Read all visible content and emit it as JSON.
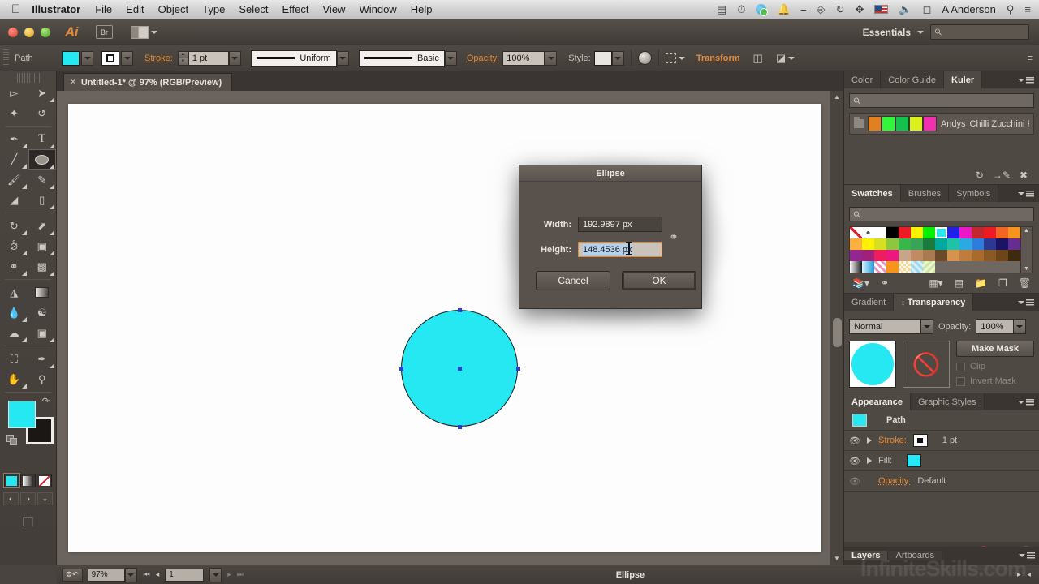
{
  "os_menu": {
    "apple_glyph": "\u0000",
    "app_name": "Illustrator",
    "items": [
      "File",
      "Edit",
      "Object",
      "Type",
      "Select",
      "Effect",
      "View",
      "Window",
      "Help"
    ],
    "user": "A Anderson",
    "right_icons": [
      "battery-icon",
      "clock-icon",
      "dropbox-icon",
      "bell-icon",
      "message-icon",
      "accessibility-icon",
      "time-machine-icon",
      "bluetooth-icon",
      "flag-icon",
      "volume-icon",
      "clock-icon",
      "spotlight-icon",
      "notification-center-icon"
    ]
  },
  "titlebar": {
    "logo": "Ai",
    "bridge_label": "Br",
    "workspace": "Essentials",
    "search_placeholder": ""
  },
  "control_bar": {
    "object_label": "Path",
    "fill_color": "#25e8f2",
    "stroke_label": "Stroke:",
    "stroke_weight": "1 pt",
    "profile": "Uniform",
    "brush": "Basic",
    "opacity_label": "Opacity:",
    "opacity_value": "100%",
    "style_label": "Style:",
    "transform_label": "Transform"
  },
  "document_tab": {
    "close_glyph": "×",
    "title": "Untitled-1* @ 97% (RGB/Preview)"
  },
  "canvas": {
    "shape_fill": "#25e8f2",
    "shape_stroke": "#1b1a1b",
    "anchor_color": "#2b3fd8"
  },
  "dialog": {
    "title": "Ellipse",
    "width_label": "Width:",
    "width_value": "192.9897 px",
    "height_label": "Height:",
    "height_value": "148.4536 px",
    "constrain_icon": "broken-chain-icon",
    "cancel_label": "Cancel",
    "ok_label": "OK"
  },
  "panels": {
    "kuler": {
      "tabs": [
        "Color",
        "Color Guide",
        "Kuler"
      ],
      "active_tab": "Kuler",
      "search_placeholder": "",
      "theme_name": "Andys",
      "theme_desc": "Chilli Zucchini P...",
      "theme_swatches": [
        "#e08020",
        "#34f53c",
        "#14c14c",
        "#dcf01c",
        "#f030b0"
      ],
      "footer_icons": [
        "refresh-icon",
        "add-theme-icon",
        "edit-theme-icon"
      ]
    },
    "swatches": {
      "tabs": [
        "Swatches",
        "Brushes",
        "Symbols"
      ],
      "active_tab": "Swatches",
      "search_placeholder": "",
      "selected_index": 7,
      "rows": [
        [
          "none",
          "#ffffff",
          "#ffffff",
          "#000000",
          "#ed1c24",
          "#fff200",
          "#00f000",
          "#25e8f2",
          "#2020e8",
          "#ec18c8",
          "#c1272d",
          "#ed1c24",
          "#f26522",
          "#f7941d",
          "#fbb040"
        ],
        [
          "#fff200",
          "#d7df23",
          "#8dc63f",
          "#39b54a",
          "#3aa35a",
          "#1b7a3d",
          "#00a99d",
          "#1fc2a7",
          "#29abe2",
          "#2e7ddd",
          "#2b3990",
          "#1b1464",
          "#662d91",
          "#92278f",
          "#a1207a"
        ],
        [
          "#ec1e5f",
          "#ed187f",
          "#c9a38a",
          "#c08a63",
          "#a97c50",
          "#6b4a2a",
          "#d9924e",
          "#c07c3a",
          "#a96b2c",
          "#8a5a22",
          "#6e4518",
          "#3f2a10",
          "#gradient-bw",
          "#gradient-cyan",
          "#pattern-pink"
        ],
        [
          "#f7941d",
          "#pattern-check",
          "#pattern-blue",
          "#pattern-green"
        ]
      ],
      "footer_icons": [
        "library-icon",
        "link-icon",
        "show-kind-icon",
        "options-icon",
        "folder-icon",
        "new-swatch-icon",
        "trash-icon"
      ]
    },
    "transparency": {
      "tabs": [
        "Gradient",
        "Transparency"
      ],
      "active_tab": "Transparency",
      "blend_mode": "Normal",
      "opacity_label": "Opacity:",
      "opacity_value": "100%",
      "make_mask_label": "Make Mask",
      "clip_label": "Clip",
      "invert_mask_label": "Invert Mask",
      "thumb_color": "#25e8f2"
    },
    "appearance": {
      "tabs": [
        "Appearance",
        "Graphic Styles"
      ],
      "active_tab": "Appearance",
      "rows": [
        {
          "name": "Path",
          "value": "",
          "chip": "#25e8f2",
          "type": "object"
        },
        {
          "name": "Stroke:",
          "value": "1 pt",
          "chip": "#121010",
          "type": "attr"
        },
        {
          "name": "Fill:",
          "value": "",
          "chip": "#25e8f2",
          "type": "attr"
        },
        {
          "name": "Opacity:",
          "value": "Default",
          "chip": "",
          "type": "dim"
        }
      ],
      "footer_icons": [
        "add-new-stroke-icon",
        "add-new-fill-icon",
        "add-effect-icon",
        "clear-appearance-icon",
        "duplicate-item-icon",
        "delete-item-icon"
      ]
    },
    "bottom_tabs": [
      "Layers",
      "Artboards"
    ]
  },
  "status_bar": {
    "zoom": "97%",
    "artboard_number": "1",
    "tool_name": "Ellipse"
  },
  "watermark": "InfiniteSkills.com",
  "tools": {
    "items": [
      "selection-tool",
      "direct-selection-tool",
      "magic-wand-tool",
      "lasso-tool",
      "pen-tool",
      "type-tool",
      "line-segment-tool",
      "ellipse-tool",
      "paintbrush-tool",
      "pencil-tool",
      "blob-brush-tool",
      "eraser-tool",
      "rotate-tool",
      "scale-tool",
      "width-tool",
      "free-transform-tool",
      "shape-builder-tool",
      "perspective-grid-tool",
      "mesh-tool",
      "gradient-tool",
      "eyedropper-tool",
      "blend-tool",
      "symbol-sprayer-tool",
      "column-graph-tool",
      "artboard-tool",
      "slice-tool",
      "hand-tool",
      "zoom-tool"
    ],
    "selected": "ellipse-tool",
    "fill_color": "#25e8f2",
    "stroke_color": "#1a1714"
  }
}
